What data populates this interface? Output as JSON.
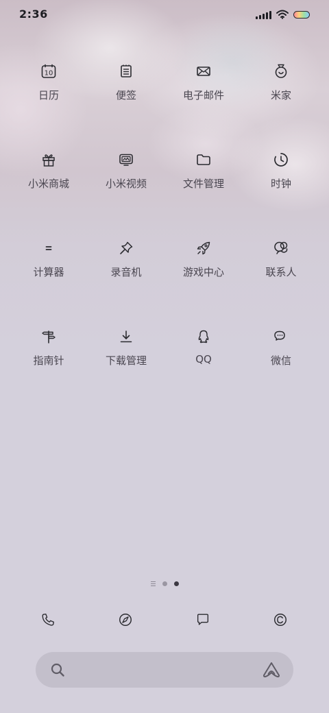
{
  "status_bar": {
    "time": "2:36",
    "icons": [
      "signal-icon",
      "wifi-icon",
      "battery-icon"
    ]
  },
  "apps": [
    {
      "label": "日历",
      "icon": "calendar-icon",
      "icon_text": "10"
    },
    {
      "label": "便签",
      "icon": "notes-icon"
    },
    {
      "label": "电子邮件",
      "icon": "email-icon"
    },
    {
      "label": "米家",
      "icon": "mijia-icon"
    },
    {
      "label": "小米商城",
      "icon": "gift-icon"
    },
    {
      "label": "小米视频",
      "icon": "video-icon"
    },
    {
      "label": "文件管理",
      "icon": "folder-icon"
    },
    {
      "label": "时钟",
      "icon": "clock-icon"
    },
    {
      "label": "计算器",
      "icon": "calculator-icon",
      "icon_text": "="
    },
    {
      "label": "录音机",
      "icon": "pin-icon"
    },
    {
      "label": "游戏中心",
      "icon": "rocket-icon"
    },
    {
      "label": "联系人",
      "icon": "contacts-icon"
    },
    {
      "label": "指南针",
      "icon": "signpost-icon"
    },
    {
      "label": "下载管理",
      "icon": "download-icon"
    },
    {
      "label": "QQ",
      "icon": "qq-icon"
    },
    {
      "label": "微信",
      "icon": "wechat-icon"
    }
  ],
  "pager": {
    "pages": 2,
    "active": 2
  },
  "dock": [
    "phone-icon",
    "browser-icon",
    "messages-icon",
    "copyright-icon"
  ],
  "search": {
    "left_icon": "search-icon",
    "right_icon": "assistant-icon"
  }
}
